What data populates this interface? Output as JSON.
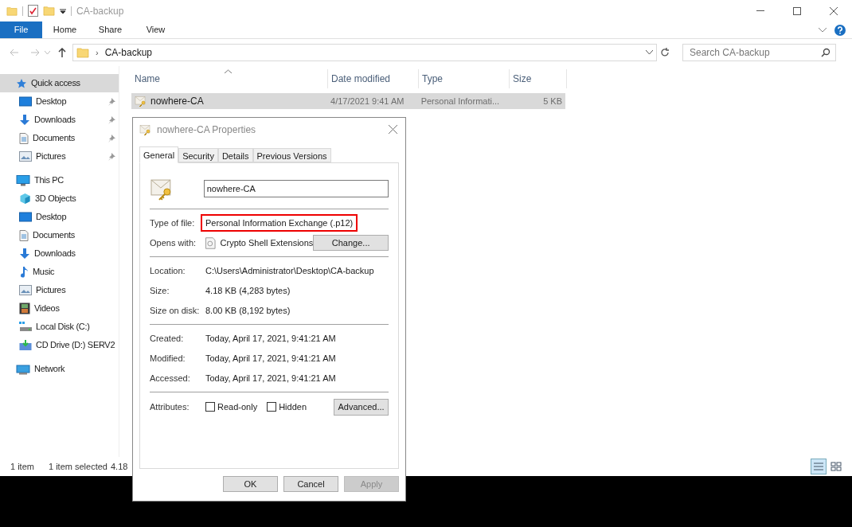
{
  "window": {
    "title": "CA-backup"
  },
  "ribbon_tabs": [
    {
      "label": "File",
      "selected": true
    },
    {
      "label": "Home",
      "selected": false
    },
    {
      "label": "Share",
      "selected": false
    },
    {
      "label": "View",
      "selected": false
    }
  ],
  "address": {
    "separator": "›",
    "path": "CA-backup"
  },
  "search": {
    "placeholder": "Search CA-backup"
  },
  "sidebar": {
    "items": [
      {
        "label": "Quick access",
        "kind": "star",
        "selected": true,
        "pinned": false,
        "children": [
          {
            "label": "Desktop",
            "kind": "desktop",
            "selected": false,
            "pinned": true
          },
          {
            "label": "Downloads",
            "kind": "download",
            "selected": false,
            "pinned": true
          },
          {
            "label": "Documents",
            "kind": "document",
            "selected": false,
            "pinned": true
          },
          {
            "label": "Pictures",
            "kind": "picture",
            "selected": false,
            "pinned": true
          }
        ]
      },
      {
        "label": "This PC",
        "kind": "pc",
        "selected": false,
        "pinned": false,
        "children": [
          {
            "label": "3D Objects",
            "kind": "cube",
            "selected": false,
            "pinned": false
          },
          {
            "label": "Desktop",
            "kind": "desktop",
            "selected": false,
            "pinned": false
          },
          {
            "label": "Documents",
            "kind": "document",
            "selected": false,
            "pinned": false
          },
          {
            "label": "Downloads",
            "kind": "download",
            "selected": false,
            "pinned": false
          },
          {
            "label": "Music",
            "kind": "music",
            "selected": false,
            "pinned": false
          },
          {
            "label": "Pictures",
            "kind": "picture",
            "selected": false,
            "pinned": false
          },
          {
            "label": "Videos",
            "kind": "video",
            "selected": false,
            "pinned": false
          },
          {
            "label": "Local Disk (C:)",
            "kind": "disk",
            "selected": false,
            "pinned": false
          },
          {
            "label": "CD Drive (D:) SERV2",
            "kind": "cd",
            "selected": false,
            "pinned": false
          }
        ]
      },
      {
        "label": "Network",
        "kind": "network",
        "selected": false,
        "pinned": false
      }
    ]
  },
  "table": {
    "columns": [
      "Name",
      "Date modified",
      "Type",
      "Size"
    ],
    "rows": [
      {
        "cells": [
          "nowhere-CA",
          "4/17/2021 9:41 AM",
          "Personal Informati...",
          "5 KB"
        ],
        "selected": true
      }
    ]
  },
  "status_bar": {
    "count": "1 item",
    "selection": "1 item selected",
    "size": "4.18"
  },
  "dialog": {
    "title": "nowhere-CA Properties",
    "tabs": [
      {
        "label": "General",
        "selected": true
      },
      {
        "label": "Security",
        "selected": false
      },
      {
        "label": "Details",
        "selected": false
      },
      {
        "label": "Previous Versions",
        "selected": false
      }
    ],
    "file_name": "nowhere-CA",
    "sections": [
      [
        {
          "label": "Type of file:",
          "value": "Personal Information Exchange (.p12)",
          "highlighted": true
        },
        {
          "label": "Opens with:",
          "value": "Crypto Shell Extensions",
          "button": "Change...",
          "highlighted": false
        }
      ],
      [
        {
          "label": "Location:",
          "value": "C:\\Users\\Administrator\\Desktop\\CA-backup",
          "highlighted": false
        },
        {
          "label": "Size:",
          "value": "4.18 KB (4,283 bytes)",
          "highlighted": false
        },
        {
          "label": "Size on disk:",
          "value": "8.00 KB (8,192 bytes)",
          "highlighted": false
        }
      ],
      [
        {
          "label": "Created:",
          "value": "Today, April 17, 2021, 9:41:21 AM",
          "highlighted": false
        },
        {
          "label": "Modified:",
          "value": "Today, April 17, 2021, 9:41:21 AM",
          "highlighted": false
        },
        {
          "label": "Accessed:",
          "value": "Today, April 17, 2021, 9:41:21 AM",
          "highlighted": false
        }
      ]
    ],
    "attributes": {
      "label": "Attributes:",
      "checkboxes": [
        {
          "label": "Read-only",
          "checked": false
        },
        {
          "label": "Hidden",
          "checked": false
        }
      ],
      "button": "Advanced..."
    },
    "buttons": [
      {
        "label": "OK",
        "disabled": false
      },
      {
        "label": "Cancel",
        "disabled": false
      },
      {
        "label": "Apply",
        "disabled": true
      }
    ]
  }
}
